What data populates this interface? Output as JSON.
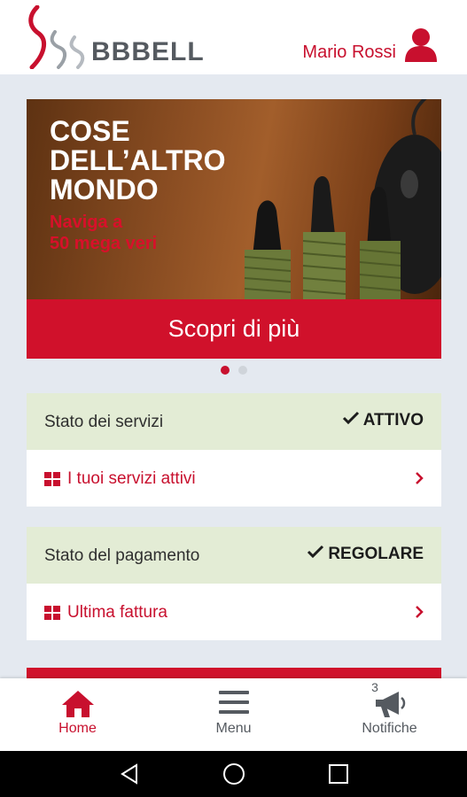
{
  "header": {
    "brand": "BBBELL",
    "user_name": "Mario Rossi"
  },
  "banner": {
    "title": "COSE\nDELL’ALTRO\nMONDO",
    "subtitle": "Naviga a\n50 mega veri",
    "cta_label": "Scopri di più",
    "slides_total": 2,
    "active_slide": 1
  },
  "services_card": {
    "status_label": "Stato dei servizi",
    "status_value": "ATTIVO",
    "link_label": "I tuoi servizi attivi"
  },
  "payment_card": {
    "status_label": "Stato del pagamento",
    "status_value": "REGOLARE",
    "link_label": "Ultima fattura"
  },
  "bottom_nav": {
    "home_label": "Home",
    "menu_label": "Menu",
    "notifications_label": "Notifiche",
    "notifications_count": "3"
  },
  "colors": {
    "brand_red": "#c8102e",
    "status_green_bg": "#e3ecd5",
    "page_bg": "#e4e9f0"
  },
  "icons": [
    "logo-icon",
    "user-icon",
    "check-icon",
    "grid-icon",
    "chevron-right-icon",
    "home-icon",
    "menu-icon",
    "megaphone-icon",
    "back-icon",
    "circle-home-icon",
    "square-recents-icon"
  ]
}
